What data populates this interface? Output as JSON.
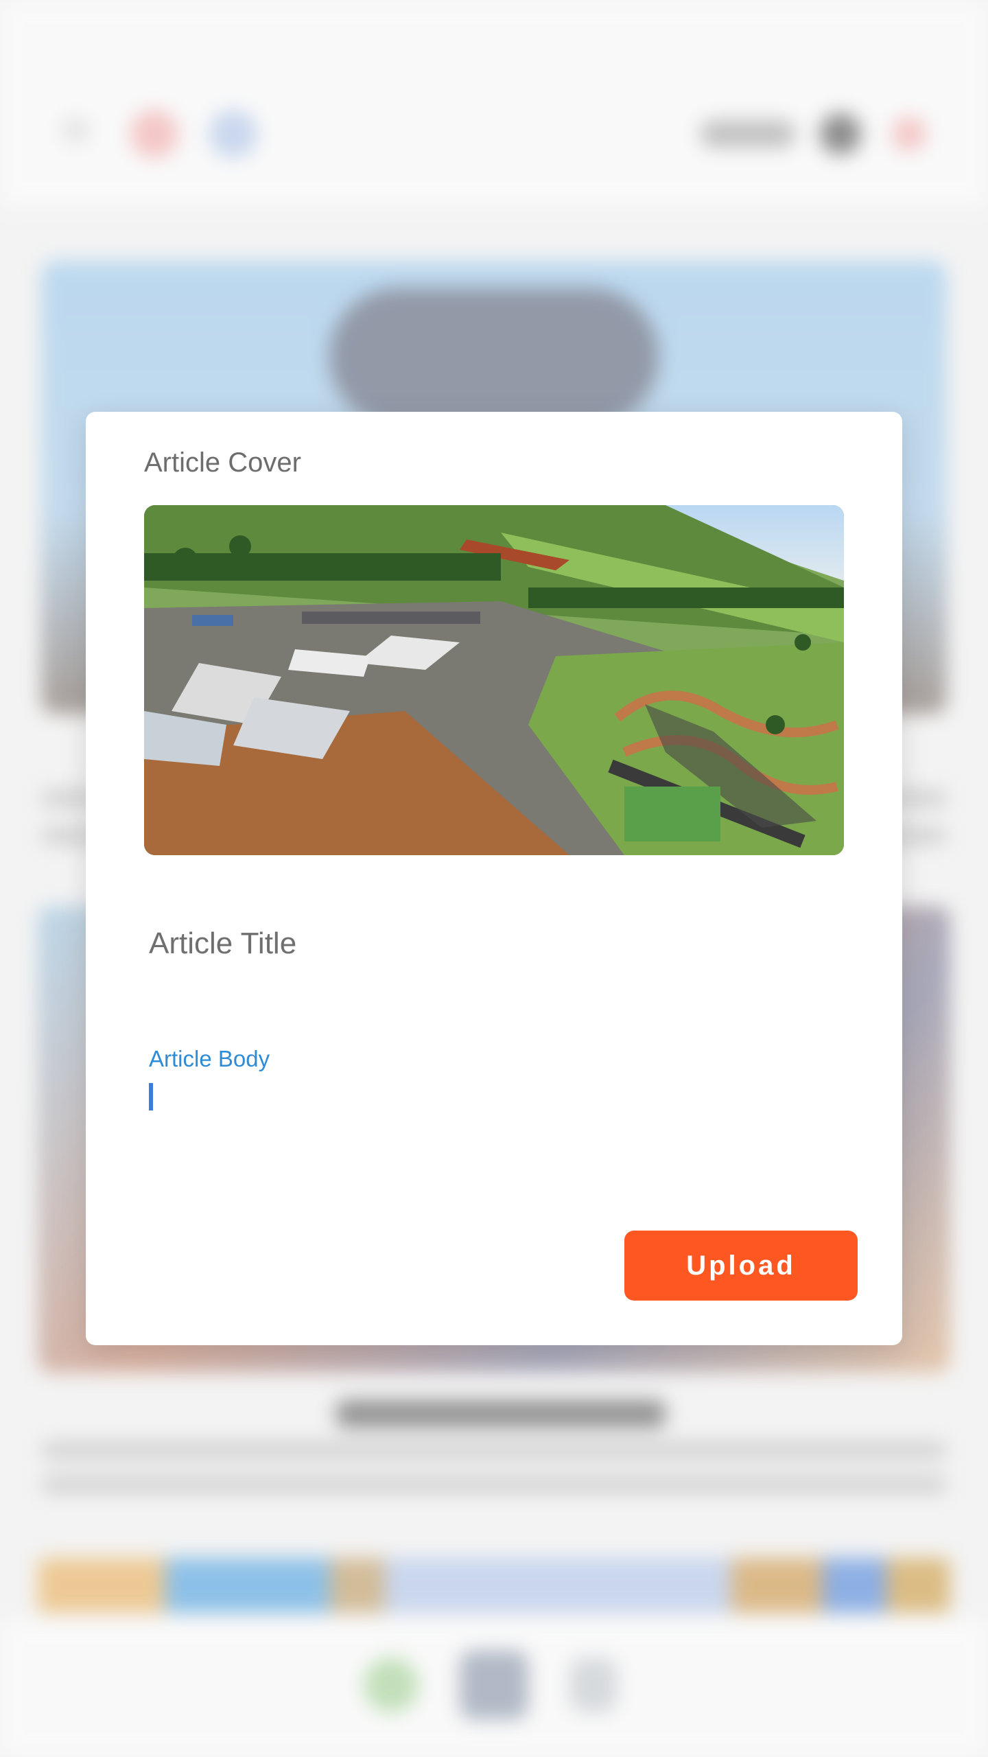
{
  "modal": {
    "cover_label": "Article Cover",
    "title_placeholder": "Article Title",
    "body_label": "Article Body",
    "upload_label": "Upload"
  },
  "colors": {
    "accent": "#ff5722",
    "body_label": "#2e8bd6",
    "caret": "#3b7ddd"
  },
  "icons": {
    "cover_image": "aerial-farm-image"
  }
}
